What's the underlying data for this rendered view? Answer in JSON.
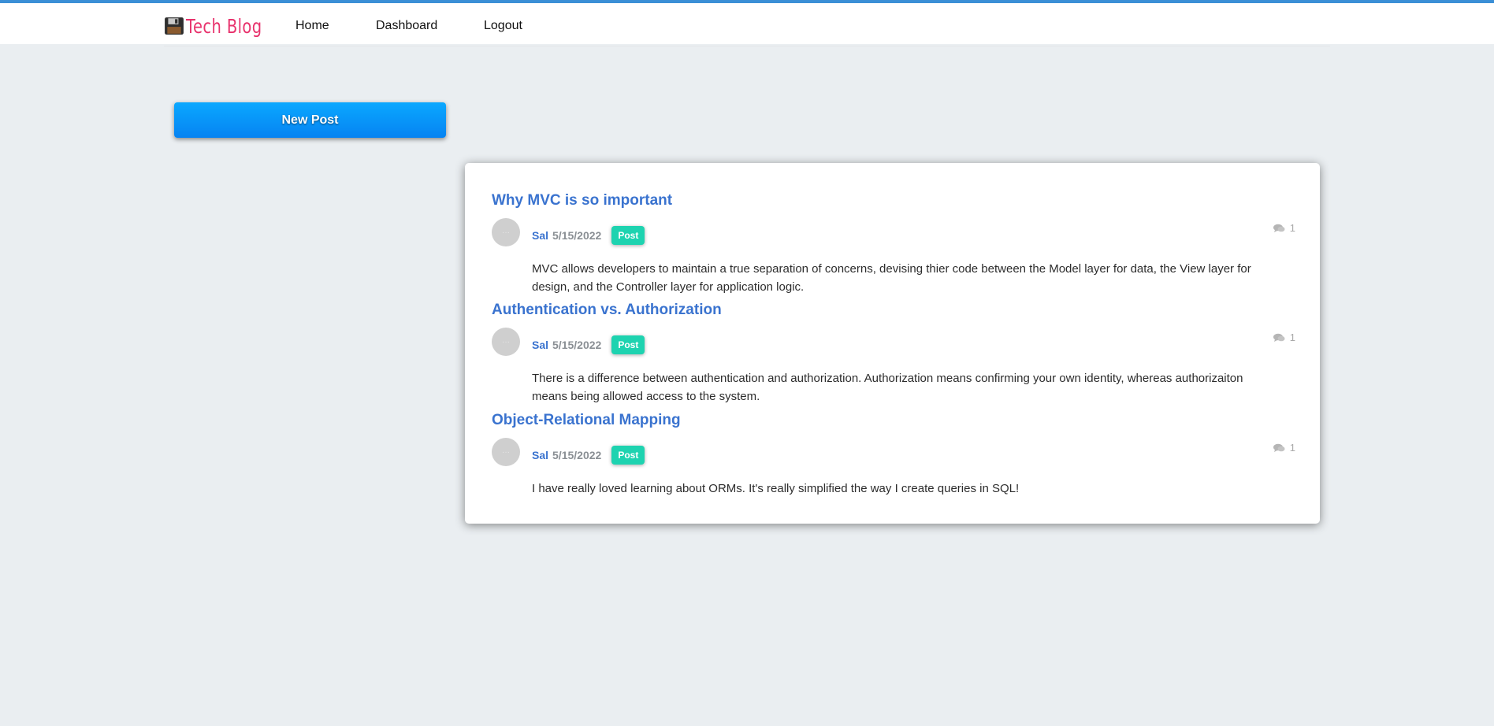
{
  "header": {
    "brand": "Tech Blog",
    "brand_icon": "floppy-disk-icon",
    "brand_color": "#e8336d",
    "accent_color": "#3b8fd6",
    "nav": [
      {
        "label": "Home"
      },
      {
        "label": "Dashboard"
      },
      {
        "label": "Logout"
      }
    ]
  },
  "sidebar": {
    "new_post_label": "New Post",
    "button_color": "#0a96fa"
  },
  "posts": [
    {
      "title": "Why MVC is so important",
      "author": "Sal",
      "date": "5/15/2022",
      "badge": "Post",
      "comments": "1",
      "comment_icon": "comments-icon",
      "body": "MVC allows developers to maintain a true separation of concerns, devising thier code between the Model layer for data, the View layer for design, and the Controller layer for application logic."
    },
    {
      "title": "Authentication vs. Authorization",
      "author": "Sal",
      "date": "5/15/2022",
      "badge": "Post",
      "comments": "1",
      "comment_icon": "comments-icon",
      "body": "There is a difference between authentication and authorization. Authorization means confirming your own identity, whereas authorizaiton means being allowed access to the system."
    },
    {
      "title": "Object-Relational Mapping",
      "author": "Sal",
      "date": "5/15/2022",
      "badge": "Post",
      "comments": "1",
      "comment_icon": "comments-icon",
      "body": "I have really loved learning about ORMs. It's really simplified the way I create queries in SQL!"
    }
  ],
  "colors": {
    "link": "#3a73cf",
    "badge": "#1ed3b0",
    "background": "#eaeef1"
  }
}
